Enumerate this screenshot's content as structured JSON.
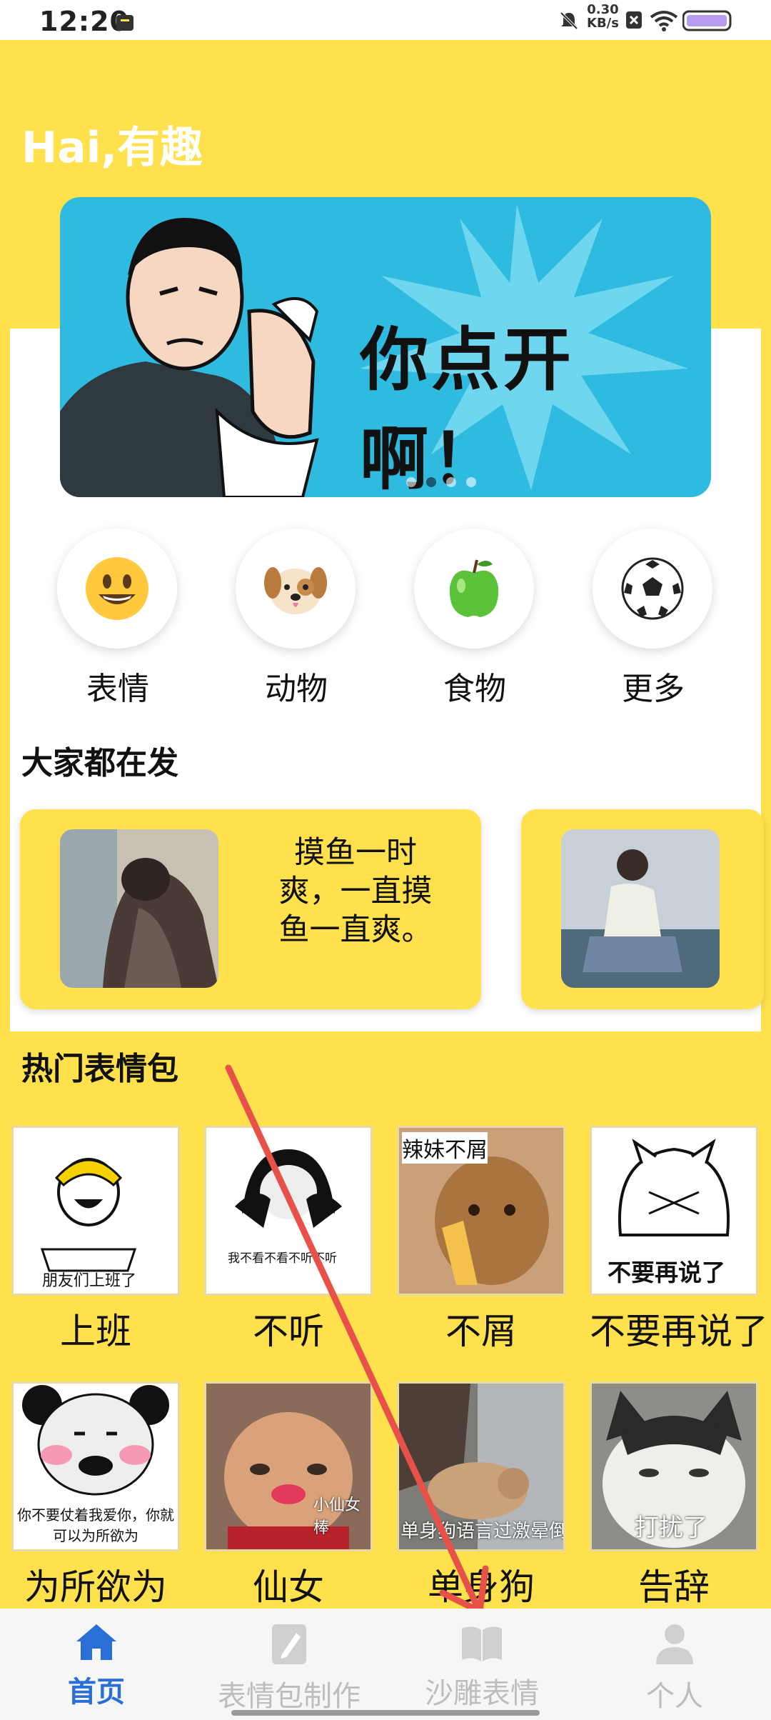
{
  "status_bar": {
    "time": "12:20",
    "net_speed": "0.30",
    "net_unit": "KB/s"
  },
  "header": {
    "greeting": "Hai,有趣"
  },
  "banner": {
    "headline": "你点开啊！"
  },
  "categories": [
    {
      "label": "表情",
      "icon": "smiley-face-icon"
    },
    {
      "label": "动物",
      "icon": "dog-face-icon"
    },
    {
      "label": "食物",
      "icon": "green-apple-icon"
    },
    {
      "label": "更多",
      "icon": "soccer-ball-icon"
    }
  ],
  "trending": {
    "title": "大家都在发",
    "cards": [
      {
        "text": "摸鱼一时爽，一直摸鱼一直爽。"
      }
    ]
  },
  "hot": {
    "title": "热门表情包",
    "items": [
      {
        "caption": "上班",
        "overlay": "朋友们上班了"
      },
      {
        "caption": "不听",
        "overlay": "我不看不看不听不听"
      },
      {
        "caption": "不屑",
        "overlay": "辣妹不屑"
      },
      {
        "caption": "不要再说了",
        "overlay": "不要再说了"
      },
      {
        "caption": "为所欲为",
        "overlay": "你不要仗着我爱你，你就可以为所欲为"
      },
      {
        "caption": "仙女",
        "overlay": "小仙女棒"
      },
      {
        "caption": "单身狗",
        "overlay": "单身狗语言过激晕倒"
      },
      {
        "caption": "告辞",
        "overlay": "打扰了"
      }
    ]
  },
  "tabbar": {
    "tabs": [
      {
        "label": "首页"
      },
      {
        "label": "表情包制作"
      },
      {
        "label": "沙雕表情"
      },
      {
        "label": "个人"
      }
    ]
  },
  "colors": {
    "background": "#FFE14D",
    "active_tab": "#2a6fd6",
    "inactive_tab": "#bdbdbd"
  }
}
